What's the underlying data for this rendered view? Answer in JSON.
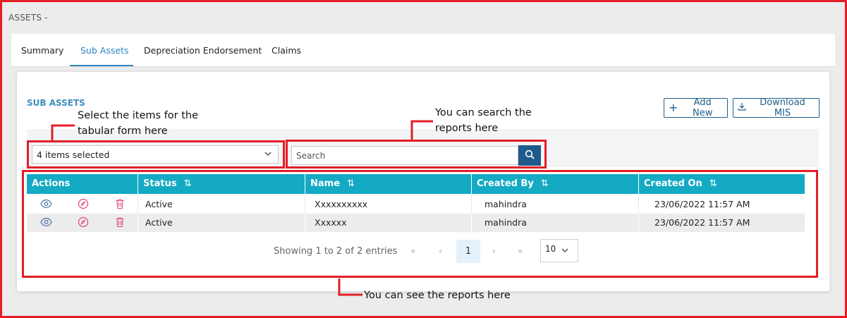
{
  "page": {
    "title": "ASSETS -"
  },
  "tabs": [
    {
      "label": "Summary",
      "active": false
    },
    {
      "label": "Sub Assets",
      "active": true
    },
    {
      "label": "Depreciation Endorsement",
      "active": false
    },
    {
      "label": "Claims",
      "active": false
    }
  ],
  "section": {
    "title": "SUB ASSETS"
  },
  "buttons": {
    "add_new": "Add New",
    "download_mis": "Download MIS"
  },
  "filters": {
    "select_value": "4 items selected",
    "search_placeholder": "Search"
  },
  "table": {
    "columns": [
      "Actions",
      "Status",
      "Name",
      "Created By",
      "Created On"
    ],
    "rows": [
      {
        "status": "Active",
        "name": "Xxxxxxxxxx",
        "created_by": "mahindra",
        "created_on": "23/06/2022 11:57 AM"
      },
      {
        "status": "Active",
        "name": "Xxxxxx",
        "created_by": "mahindra",
        "created_on": "23/06/2022 11:57 AM"
      }
    ],
    "row_actions": [
      "eye-icon",
      "edit-icon",
      "trash-icon"
    ]
  },
  "pagination": {
    "info": "Showing 1 to 2 of 2 entries",
    "first": "«",
    "prev": "‹",
    "current_page": "1",
    "next": "›",
    "last": "»",
    "page_size": "10"
  },
  "annotations": {
    "select_hint_line1": "Select the items for the",
    "select_hint_line2": "tabular form here",
    "search_hint_line1": "You can search the",
    "search_hint_line2": "reports here",
    "reports_hint": "You can see the reports here"
  },
  "colors": {
    "accent": "#2e86c1",
    "header": "#14aac3",
    "primary_dark": "#1f5a8c",
    "annotation_red": "#e41e26",
    "edit_pink": "#e0457b",
    "eye_blue": "#4a6fa5"
  }
}
